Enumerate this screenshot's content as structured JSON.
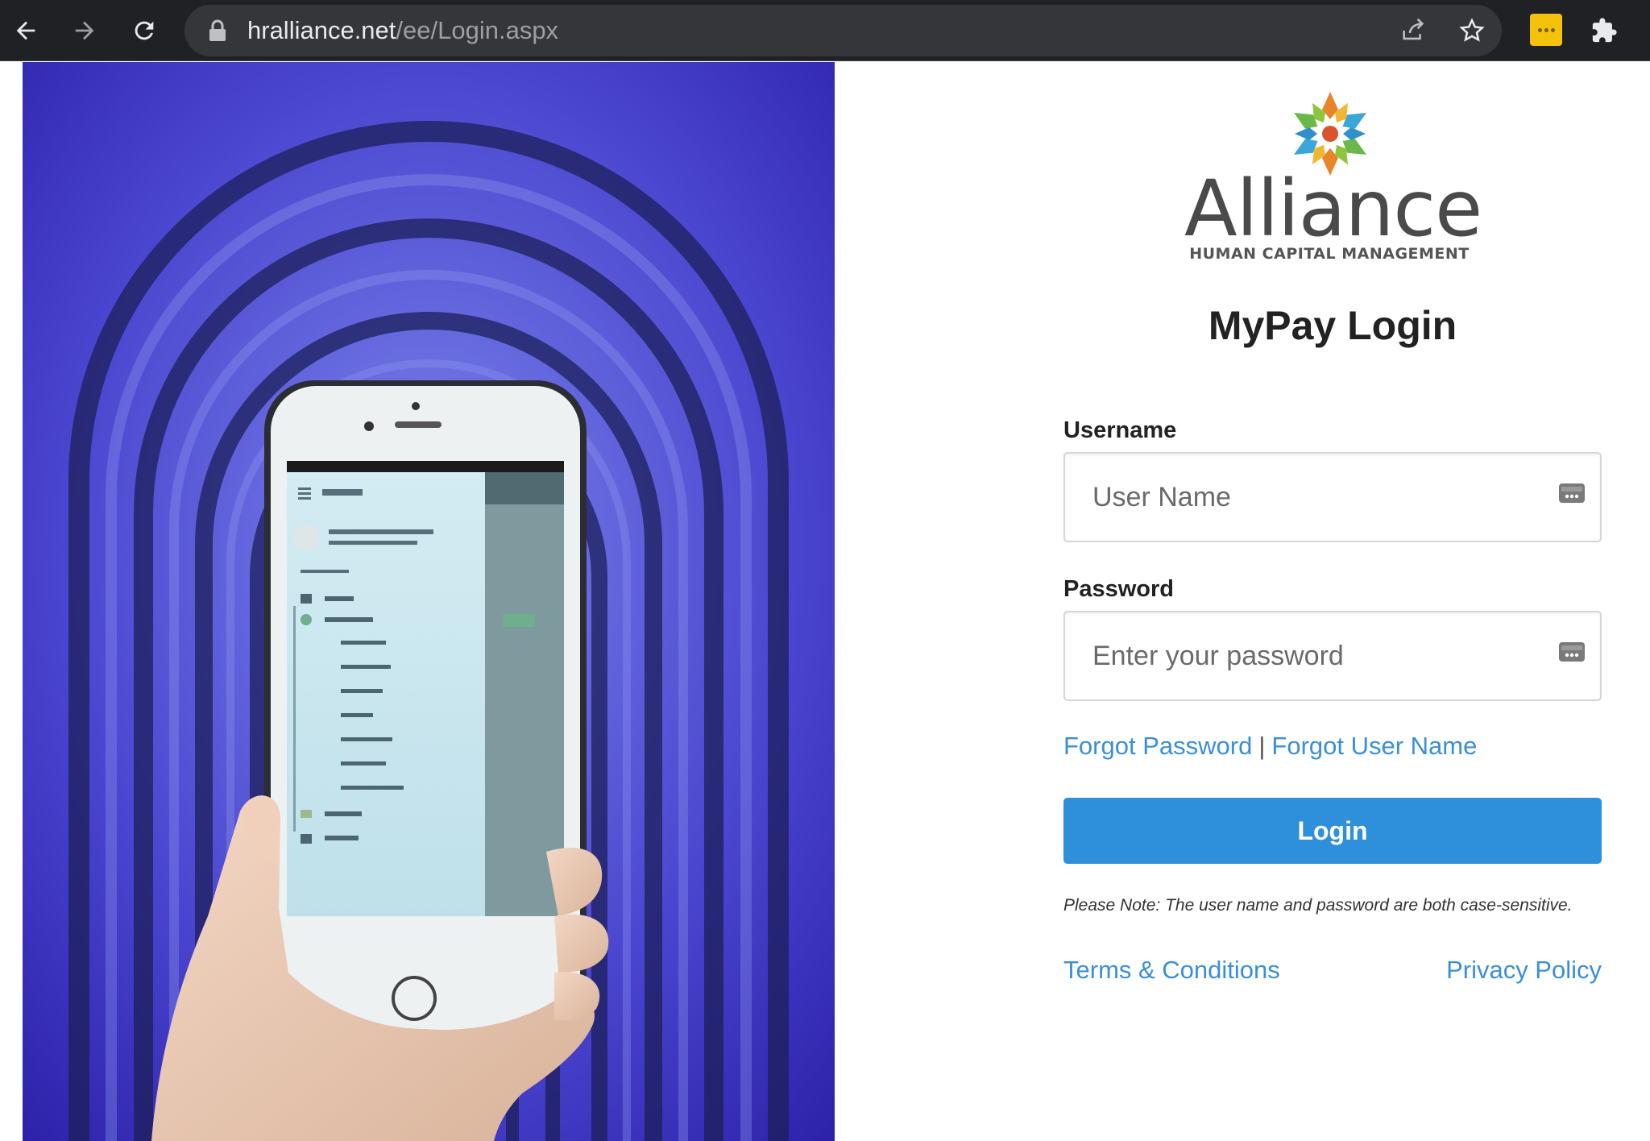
{
  "browser": {
    "url_host": "hralliance.net",
    "url_path": "/ee/Login.aspx",
    "icons": [
      "back-arrow-icon",
      "forward-arrow-icon",
      "reload-icon",
      "lock-icon",
      "share-icon",
      "star-icon",
      "extension-badge-icon",
      "puzzle-icon"
    ]
  },
  "logo": {
    "wordmark": "Alliance",
    "tagline": "HUMAN CAPITAL MANAGEMENT"
  },
  "login": {
    "title": "MyPay Login",
    "username_label": "Username",
    "username_placeholder": "User Name",
    "password_label": "Password",
    "password_placeholder": "Enter your password",
    "forgot_password": "Forgot Password",
    "separator": "|",
    "forgot_username": "Forgot User Name",
    "submit_label": "Login",
    "note": "Please Note: The user name and password are both case-sensitive.",
    "terms_link": "Terms & Conditions",
    "privacy_link": "Privacy Policy"
  },
  "colors": {
    "toolbar_bg": "#202124",
    "link": "#3a8fd8",
    "button_bg": "#2e8fdb",
    "hero_bg": "#3a2fb8"
  }
}
